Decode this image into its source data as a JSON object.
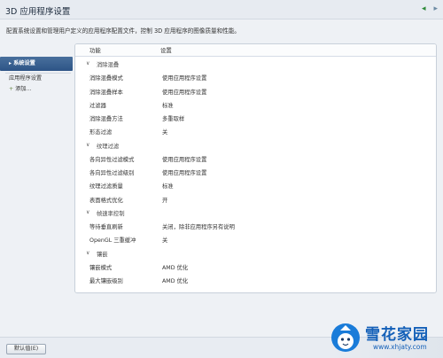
{
  "window": {
    "title": "3D 应用程序设置",
    "back_icon": "back-arrow-icon",
    "forward_icon": "forward-arrow-icon"
  },
  "description": "配置系统设置和管理用户定义的应用程序配置文件，控制 3D 应用程序的图像质量和性能。",
  "sidebar": {
    "items": [
      {
        "label": "系统设置",
        "active": true
      },
      {
        "label": "应用程序设置",
        "active": false
      },
      {
        "label": "添加...",
        "active": false
      }
    ]
  },
  "table": {
    "headers": {
      "feature": "功能",
      "setting": "设置"
    },
    "groups": [
      {
        "title": "消除混叠",
        "rows": [
          {
            "feature": "消除混叠模式",
            "setting": "使用应用程序设置"
          },
          {
            "feature": "消除混叠样本",
            "setting": "使用应用程序设置"
          },
          {
            "feature": "过滤器",
            "setting": "标准"
          },
          {
            "feature": "消除混叠方法",
            "setting": "多重取样"
          },
          {
            "feature": "形态过滤",
            "setting": "关"
          }
        ]
      },
      {
        "title": "纹理过滤",
        "rows": [
          {
            "feature": "各向异性过滤模式",
            "setting": "使用应用程序设置"
          },
          {
            "feature": "各向异性过滤级别",
            "setting": "使用应用程序设置"
          },
          {
            "feature": "纹理过滤质量",
            "setting": "标准"
          },
          {
            "feature": "表面格式优化",
            "setting": "开"
          }
        ]
      },
      {
        "title": "帧速率控制",
        "rows": [
          {
            "feature": "等待垂直刷新",
            "setting": "关闭，除非应用程序另有说明"
          },
          {
            "feature": "OpenGL 三重缓冲",
            "setting": "关"
          }
        ]
      },
      {
        "title": "镶嵌",
        "rows": [
          {
            "feature": "镶嵌模式",
            "setting": "AMD 优化"
          },
          {
            "feature": "最大镶嵌级别",
            "setting": "AMD 优化"
          }
        ]
      }
    ]
  },
  "footer": {
    "default_button": "默认值(E)"
  },
  "watermark": {
    "title": "雪花家园",
    "url": "www.xhjaty.com"
  },
  "colors": {
    "accent": "#2d5486",
    "watermark": "#1460b8"
  }
}
